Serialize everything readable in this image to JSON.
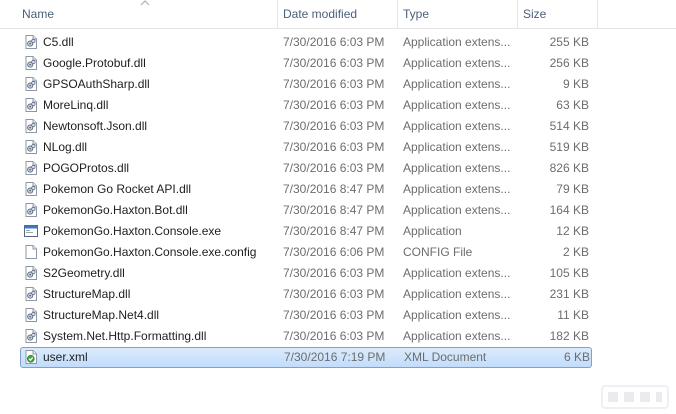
{
  "columns": {
    "name": "Name",
    "date_modified": "Date modified",
    "type": "Type",
    "size": "Size"
  },
  "sort": {
    "column": "name",
    "direction": "ascending"
  },
  "colors": {
    "selection_border": "#7da2ce",
    "selection_fill": "#cce4fc",
    "header_text": "#4c607a"
  },
  "files": [
    {
      "name": "C5.dll",
      "date": "7/30/2016 6:03 PM",
      "type": "Application extens...",
      "size": "255 KB",
      "icon": "dll-file-icon",
      "selected": false
    },
    {
      "name": "Google.Protobuf.dll",
      "date": "7/30/2016 6:03 PM",
      "type": "Application extens...",
      "size": "256 KB",
      "icon": "dll-file-icon",
      "selected": false
    },
    {
      "name": "GPSOAuthSharp.dll",
      "date": "7/30/2016 6:03 PM",
      "type": "Application extens...",
      "size": "9 KB",
      "icon": "dll-file-icon",
      "selected": false
    },
    {
      "name": "MoreLinq.dll",
      "date": "7/30/2016 6:03 PM",
      "type": "Application extens...",
      "size": "63 KB",
      "icon": "dll-file-icon",
      "selected": false
    },
    {
      "name": "Newtonsoft.Json.dll",
      "date": "7/30/2016 6:03 PM",
      "type": "Application extens...",
      "size": "514 KB",
      "icon": "dll-file-icon",
      "selected": false
    },
    {
      "name": "NLog.dll",
      "date": "7/30/2016 6:03 PM",
      "type": "Application extens...",
      "size": "519 KB",
      "icon": "dll-file-icon",
      "selected": false
    },
    {
      "name": "POGOProtos.dll",
      "date": "7/30/2016 6:03 PM",
      "type": "Application extens...",
      "size": "826 KB",
      "icon": "dll-file-icon",
      "selected": false
    },
    {
      "name": "Pokemon Go Rocket API.dll",
      "date": "7/30/2016 8:47 PM",
      "type": "Application extens...",
      "size": "79 KB",
      "icon": "dll-file-icon",
      "selected": false
    },
    {
      "name": "PokemonGo.Haxton.Bot.dll",
      "date": "7/30/2016 8:47 PM",
      "type": "Application extens...",
      "size": "164 KB",
      "icon": "dll-file-icon",
      "selected": false
    },
    {
      "name": "PokemonGo.Haxton.Console.exe",
      "date": "7/30/2016 8:47 PM",
      "type": "Application",
      "size": "12 KB",
      "icon": "exe-application-icon",
      "selected": false
    },
    {
      "name": "PokemonGo.Haxton.Console.exe.config",
      "date": "7/30/2016 6:06 PM",
      "type": "CONFIG File",
      "size": "2 KB",
      "icon": "config-file-icon",
      "selected": false
    },
    {
      "name": "S2Geometry.dll",
      "date": "7/30/2016 6:03 PM",
      "type": "Application extens...",
      "size": "105 KB",
      "icon": "dll-file-icon",
      "selected": false
    },
    {
      "name": "StructureMap.dll",
      "date": "7/30/2016 6:03 PM",
      "type": "Application extens...",
      "size": "231 KB",
      "icon": "dll-file-icon",
      "selected": false
    },
    {
      "name": "StructureMap.Net4.dll",
      "date": "7/30/2016 6:03 PM",
      "type": "Application extens...",
      "size": "11 KB",
      "icon": "dll-file-icon",
      "selected": false
    },
    {
      "name": "System.Net.Http.Formatting.dll",
      "date": "7/30/2016 6:03 PM",
      "type": "Application extens...",
      "size": "182 KB",
      "icon": "dll-file-icon",
      "selected": false
    },
    {
      "name": "user.xml",
      "date": "7/30/2016 7:19 PM",
      "type": "XML Document",
      "size": "6 KB",
      "icon": "xml-document-icon",
      "selected": true
    }
  ]
}
